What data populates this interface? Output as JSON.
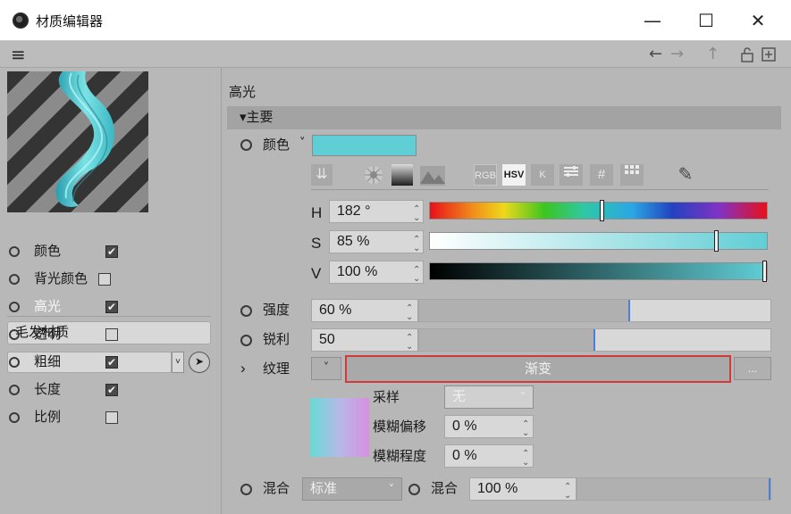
{
  "window": {
    "title": "材质编辑器",
    "min_glyph": "—",
    "max_glyph": "☐",
    "close_glyph": "✕"
  },
  "toolbar": {
    "menu_glyph": "≡",
    "back_glyph": "←",
    "forward_glyph": "→",
    "up_glyph": "↑",
    "lock_glyph": "🔓",
    "new_glyph": "⊞"
  },
  "left": {
    "material_name": "毛发材质",
    "channels": [
      {
        "label": "颜色",
        "checked": true
      },
      {
        "label": "背光颜色",
        "checked": false
      },
      {
        "label": "高光",
        "checked": true,
        "active": true
      },
      {
        "label": "透明",
        "checked": false
      },
      {
        "label": "粗细",
        "checked": true
      },
      {
        "label": "长度",
        "checked": true
      },
      {
        "label": "比例",
        "checked": false
      }
    ],
    "check_glyph": "✔"
  },
  "main": {
    "section_title": "高光",
    "group_label": "▾主要",
    "color": {
      "label": "颜色",
      "dropdown_glyph": "˅",
      "swatch": "#60ced5",
      "modes": [
        "RGB",
        "HSV",
        "K"
      ],
      "picker_glyph": "✎",
      "h": {
        "letter": "H",
        "value": "182 °",
        "fraction": 0.51
      },
      "s": {
        "letter": "S",
        "value": "85 %",
        "fraction": 0.85
      },
      "v": {
        "letter": "V",
        "value": "100 %",
        "fraction": 1.0
      }
    },
    "intensity": {
      "label": "强度",
      "value": "60 %",
      "fraction": 0.6
    },
    "sharpness": {
      "label": "锐利",
      "value": "50",
      "fraction": 0.5
    },
    "texture": {
      "expand_glyph": "›",
      "label": "纹理",
      "dropdown_glyph": "˅",
      "name": "渐变",
      "more": "...",
      "sampling_label": "采样",
      "sampling_value": "无",
      "blur_offset_label": "模糊偏移",
      "blur_offset_value": "0 %",
      "blur_amount_label": "模糊程度",
      "blur_amount_value": "0 %"
    },
    "mix": {
      "label": "混合",
      "mode": "标准",
      "strength_label": "混合",
      "strength_value": "100 %",
      "strength_fraction": 1.0
    },
    "spin_glyph": "⌃⌄"
  }
}
